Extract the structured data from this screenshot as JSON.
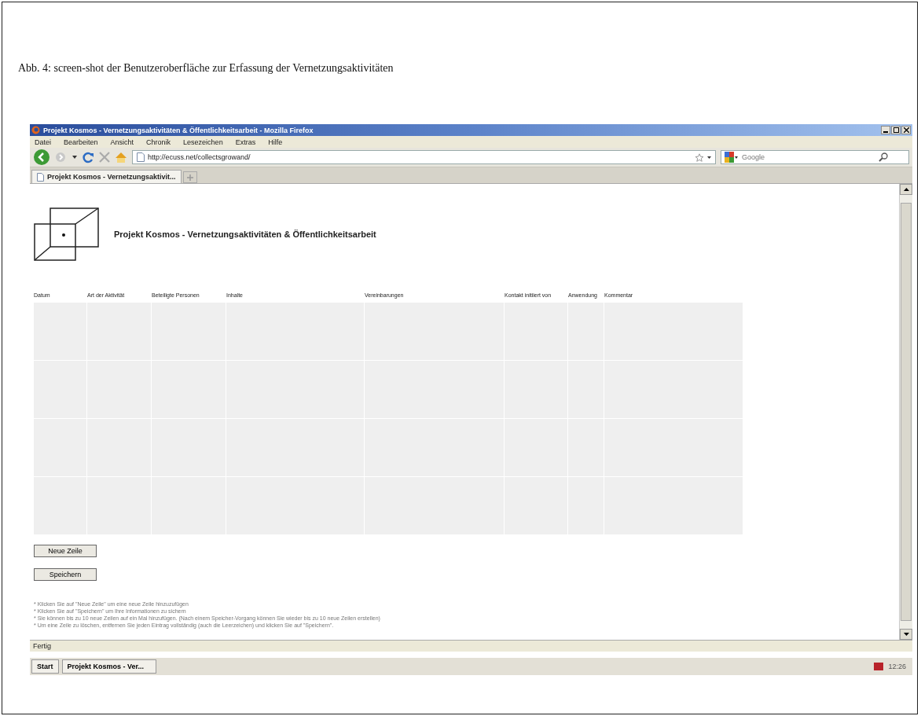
{
  "caption": "Abb. 4: screen-shot der Benutzeroberfläche zur Erfassung der Vernetzungsaktivitäten",
  "window": {
    "title": "Projekt Kosmos - Vernetzungsaktivitäten & Öffentlichkeitsarbeit - Mozilla Firefox"
  },
  "menu": [
    "Datei",
    "Bearbeiten",
    "Ansicht",
    "Chronik",
    "Lesezeichen",
    "Extras",
    "Hilfe"
  ],
  "address": {
    "value": "http://ecuss.net/collectsgrowand/"
  },
  "search": {
    "placeholder": "Google"
  },
  "tabs": [
    {
      "label": "Projekt Kosmos - Vernetzungsaktivit...",
      "selected": true
    }
  ],
  "page": {
    "heading": "Projekt Kosmos - Vernetzungsaktivitäten & Öffentlichkeitsarbeit"
  },
  "table": {
    "columns": [
      "Datum",
      "Art der Aktivität",
      "Beteiligte Personen",
      "Inhalte",
      "Vereinbarungen",
      "Kontakt initiiert von",
      "Anwendung",
      "Kommentar"
    ],
    "rows": [
      {
        "kind": "input"
      },
      {
        "kind": "input"
      },
      {
        "kind": "input"
      },
      {
        "kind": "input"
      }
    ]
  },
  "buttons": [
    "Neue Zeile",
    "Speichern"
  ],
  "notes": [
    "* Klicken Sie auf \"Neue Zeile\" um eine neue Zeile hinzuzufügen",
    "* Klicken Sie auf \"Speichern\" um Ihre Informationen zu sichern",
    "* Sie können bis zu 10 neue Zeilen auf ein Mal hinzufügen. (Nach einem Speicher-Vorgang können Sie wieder bis zu 10 neue Zeilen erstellen)",
    "* Um eine Zeile zu löschen, entfernen Sie jeden Eintrag vollständig (auch die Leerzeichen) und klicken Sie auf \"Speichern\"."
  ],
  "status_bar": "Fertig",
  "taskbar": {
    "start": "Start",
    "windows": [
      "Projekt Kosmos - Ver..."
    ],
    "clock": "12:26"
  }
}
